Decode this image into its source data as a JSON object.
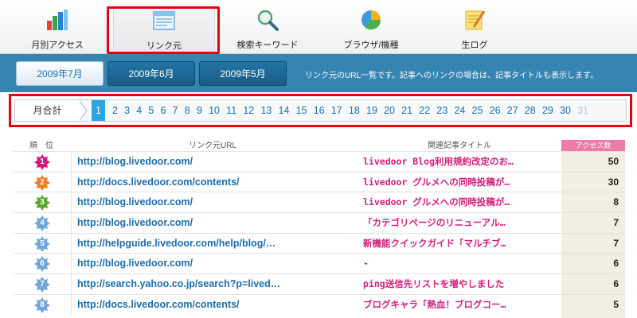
{
  "tabs": [
    {
      "label": "月別アクセス",
      "icon": "bar-chart-icon"
    },
    {
      "label": "リンク元",
      "icon": "window-icon",
      "active": true
    },
    {
      "label": "検索キーワード",
      "icon": "magnifier-icon"
    },
    {
      "label": "ブラウザ/機種",
      "icon": "pie-chart-icon"
    },
    {
      "label": "生ログ",
      "icon": "notepad-icon"
    }
  ],
  "months": [
    {
      "label": "2009年7月",
      "active": true
    },
    {
      "label": "2009年6月"
    },
    {
      "label": "2009年5月"
    }
  ],
  "month_description": "リンク元のURL一覧です。記事へのリンクの場合は、記事タイトルも表示します。",
  "day_selector": {
    "label": "月合計",
    "days": [
      "1",
      "2",
      "3",
      "4",
      "5",
      "6",
      "7",
      "8",
      "9",
      "10",
      "11",
      "12",
      "13",
      "14",
      "15",
      "16",
      "17",
      "18",
      "19",
      "20",
      "21",
      "22",
      "23",
      "24",
      "25",
      "26",
      "27",
      "28",
      "29",
      "30",
      "31"
    ],
    "selected": "1",
    "disabled": [
      "31"
    ]
  },
  "table": {
    "headers": {
      "rank": "順　位",
      "url": "リンク元URL",
      "title": "関連記事タイトル",
      "count": "アクセス数"
    },
    "rows": [
      {
        "rank": "1",
        "url": "http://blog.livedoor.com/",
        "title": "livedoor Blog利用規約改定のお…",
        "count": "50",
        "color": "#d8147c"
      },
      {
        "rank": "2",
        "url": "http://docs.livedoor.com/contents/",
        "title": "livedoor グルメへの同時投稿が…",
        "count": "30",
        "color": "#f07c1a"
      },
      {
        "rank": "3",
        "url": "http://blog.livedoor.com/",
        "title": "livedoor グルメへの同時投稿が…",
        "count": "8",
        "color": "#5aa832"
      },
      {
        "rank": "4",
        "url": "http://blog.livedoor.com/",
        "title": "「カテゴリページのリニューアル…",
        "count": "7",
        "color": "#6fa6dc"
      },
      {
        "rank": "5",
        "url": "http://helpguide.livedoor.com/help/blog/…",
        "title": "新機能クイックガイド「マルチブ…",
        "count": "7",
        "color": "#6fa6dc"
      },
      {
        "rank": "6",
        "url": "http://blog.livedoor.com/",
        "title": "-",
        "count": "6",
        "color": "#6fa6dc"
      },
      {
        "rank": "7",
        "url": "http://search.yahoo.co.jp/search?p=lived…",
        "title": "ping送信先リストを増やしました",
        "count": "6",
        "color": "#6fa6dc"
      },
      {
        "rank": "8",
        "url": "http://docs.livedoor.com/contents/",
        "title": "ブログキャラ「熱血！ブログコー…",
        "count": "5",
        "color": "#6fa6dc"
      }
    ]
  }
}
